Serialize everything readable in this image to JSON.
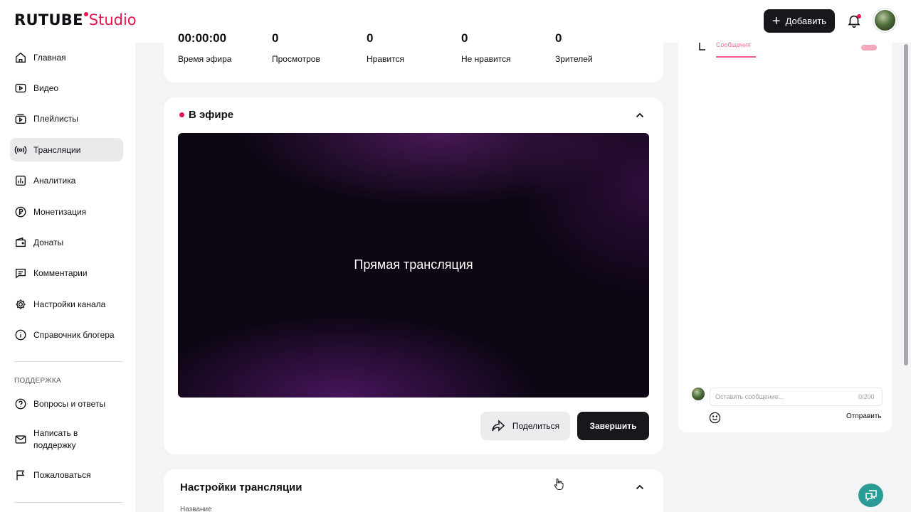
{
  "header": {
    "logo_main": "RUTUBE",
    "logo_studio": "Studio",
    "add_button": "Добавить"
  },
  "sidebar": {
    "items": [
      {
        "label": "Главная",
        "icon": "home-icon"
      },
      {
        "label": "Видео",
        "icon": "video-icon"
      },
      {
        "label": "Плейлисты",
        "icon": "playlist-icon"
      },
      {
        "label": "Трансляции",
        "icon": "broadcast-icon",
        "active": true
      },
      {
        "label": "Аналитика",
        "icon": "analytics-icon"
      },
      {
        "label": "Монетизация",
        "icon": "ruble-icon"
      },
      {
        "label": "Донаты",
        "icon": "wallet-icon"
      },
      {
        "label": "Комментарии",
        "icon": "comment-icon"
      },
      {
        "label": "Настройки канала",
        "icon": "gear-icon"
      },
      {
        "label": "Справочник блогера",
        "icon": "info-icon"
      }
    ],
    "support_title": "ПОДДЕРЖКА",
    "support_items": [
      {
        "label": "Вопросы и ответы",
        "icon": "question-icon"
      },
      {
        "label": "Написать в поддержку",
        "icon": "mail-icon"
      },
      {
        "label": "Пожаловаться",
        "icon": "flag-icon"
      }
    ]
  },
  "stats": {
    "duration_value": "00:00:00",
    "duration_label": "Время эфира",
    "views_label": "Просмотров",
    "likes_label": "Нравится",
    "dislikes_label": "Не нравится",
    "viewers_label": "Зрителей",
    "views_value": "0",
    "likes_value": "0",
    "dislikes_value": "0",
    "viewers_value": "0"
  },
  "live": {
    "title": "В эфире",
    "player_text": "Прямая трансляция",
    "share_button": "Поделиться",
    "finish_button": "Завершить"
  },
  "settings": {
    "title": "Настройки трансляции",
    "name_label": "Название"
  },
  "chat": {
    "tab_label": "Сообщения",
    "input_placeholder": "Оставить сообщение...",
    "counter": "0/200",
    "send_label": "Отправить"
  },
  "colors": {
    "accent": "#e8144d",
    "dark_button": "#17181c",
    "help_button": "#2a9c96"
  }
}
